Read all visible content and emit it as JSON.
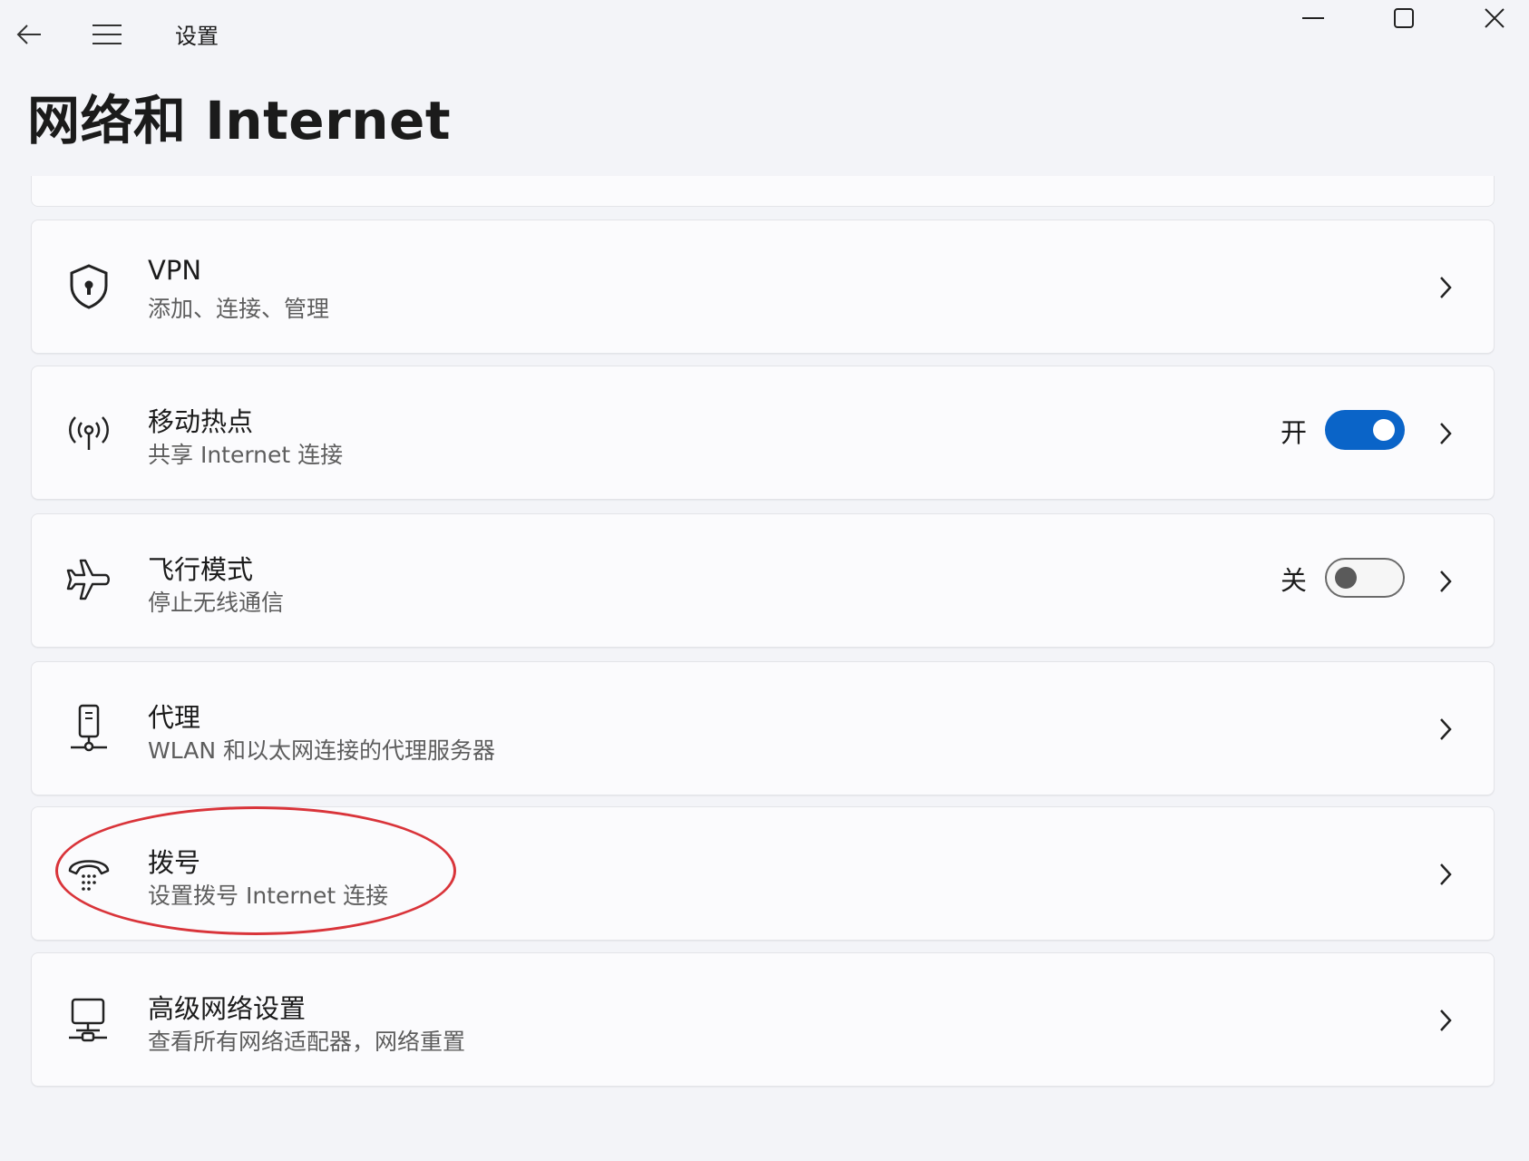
{
  "window": {
    "app_title": "设置",
    "back_icon": "back-arrow-icon",
    "menu_icon": "hamburger-icon",
    "controls": [
      "minimize-icon",
      "maximize-icon",
      "close-icon"
    ]
  },
  "page": {
    "title": "网络和 Internet"
  },
  "accent_color": "#0a64c8",
  "annotation_color": "#d9343a",
  "items": [
    {
      "icon": "vpn-shield-icon",
      "title": "VPN",
      "subtitle": "添加、连接、管理"
    },
    {
      "icon": "hotspot-icon",
      "title": "移动热点",
      "subtitle": "共享 Internet 连接",
      "state_label": "开",
      "toggle_on": true
    },
    {
      "icon": "airplane-icon",
      "title": "飞行模式",
      "subtitle": "停止无线通信",
      "state_label": "关",
      "toggle_on": false
    },
    {
      "icon": "proxy-icon",
      "title": "代理",
      "subtitle": "WLAN 和以太网连接的代理服务器"
    },
    {
      "icon": "dialup-phone-icon",
      "title": "拨号",
      "subtitle": "设置拨号 Internet 连接",
      "highlighted": true
    },
    {
      "icon": "advanced-network-icon",
      "title": "高级网络设置",
      "subtitle": "查看所有网络适配器，网络重置"
    }
  ]
}
